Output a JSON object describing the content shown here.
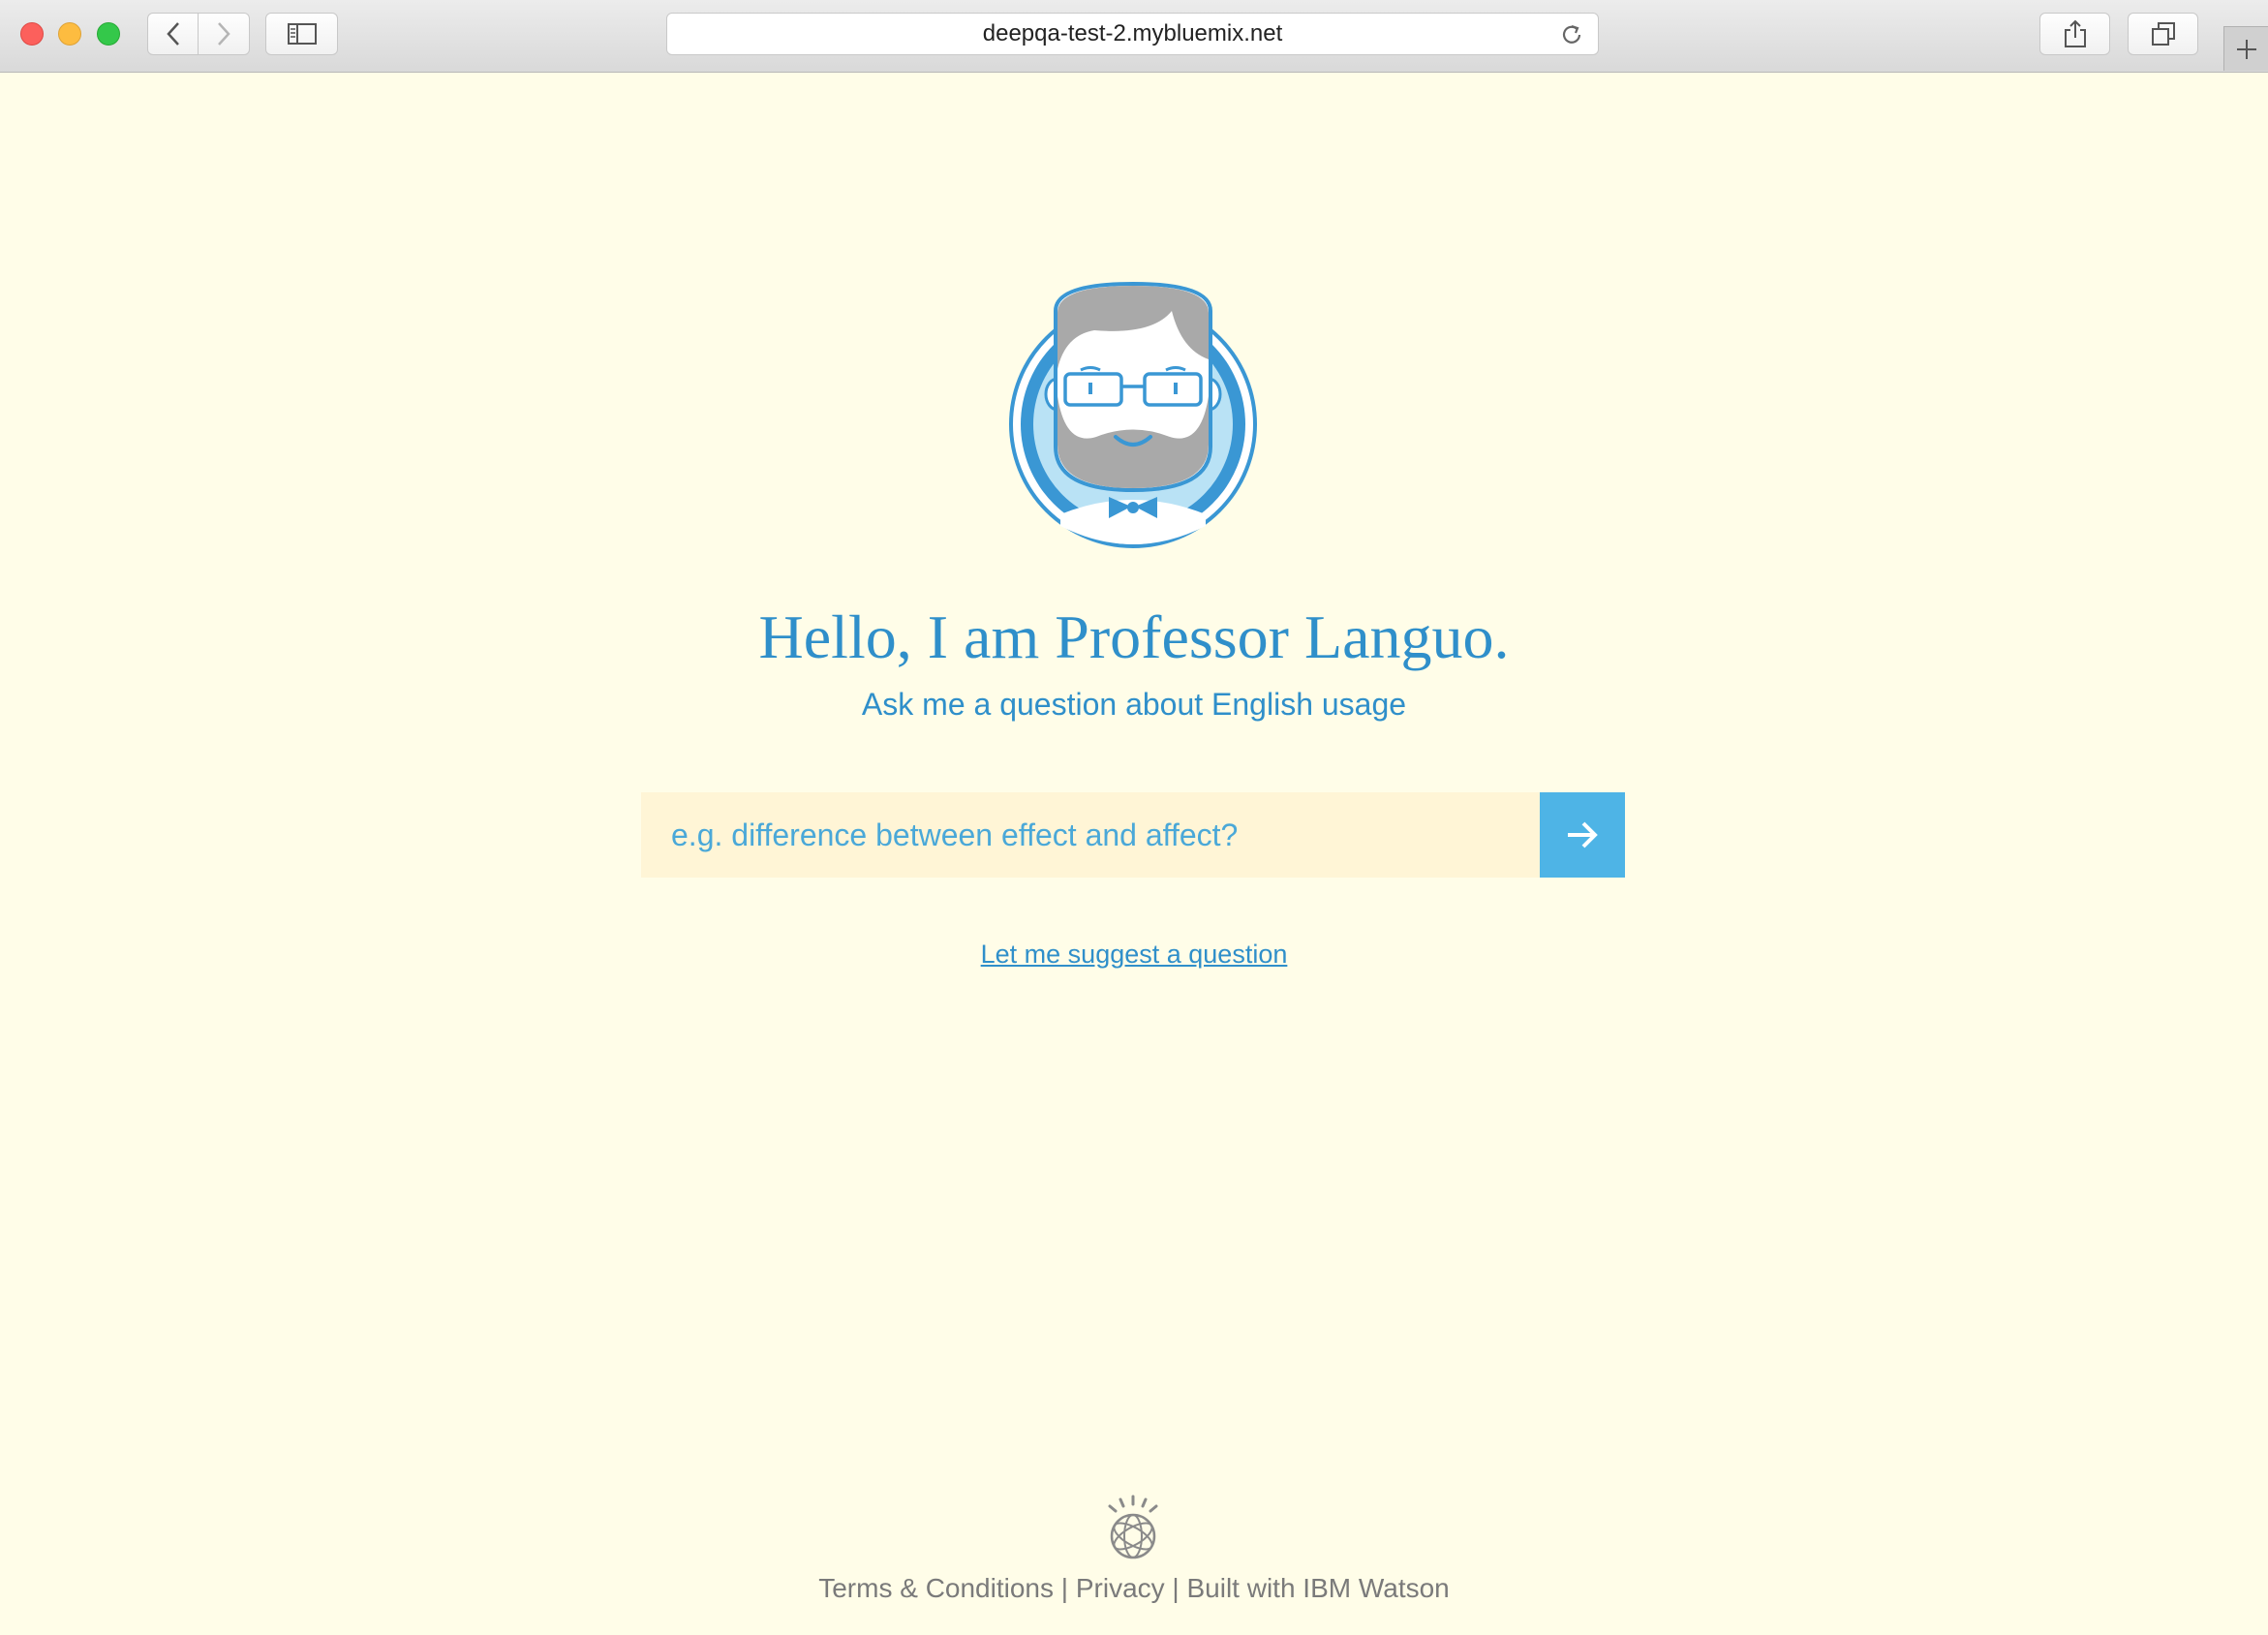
{
  "browser": {
    "url": "deepqa-test-2.mybluemix.net",
    "icons": {
      "back": "chevron-left-icon",
      "forward": "chevron-right-icon",
      "sidebar": "sidebar-icon",
      "reload": "reload-icon",
      "share": "share-icon",
      "tabs": "tabs-overview-icon",
      "new_tab": "plus-icon"
    }
  },
  "main": {
    "avatar_icon": "professor-avatar-icon",
    "title": "Hello, I am Professor Languo.",
    "subtitle": "Ask me a question about English usage",
    "search": {
      "value": "",
      "placeholder": "e.g. difference between effect and affect?",
      "submit_icon": "arrow-right-icon"
    },
    "suggest_link": "Let me suggest a question"
  },
  "footer": {
    "logo_icon": "ibm-watson-logo-icon",
    "terms": "Terms & Conditions",
    "separator": "|",
    "privacy": "Privacy",
    "built_with": "Built with IBM Watson"
  },
  "colors": {
    "background": "#fffde8",
    "accent_blue": "#2f8fca",
    "button_blue": "#4eb4e6",
    "input_bg": "#fff5d6",
    "footer_text": "#7a7a7a"
  }
}
